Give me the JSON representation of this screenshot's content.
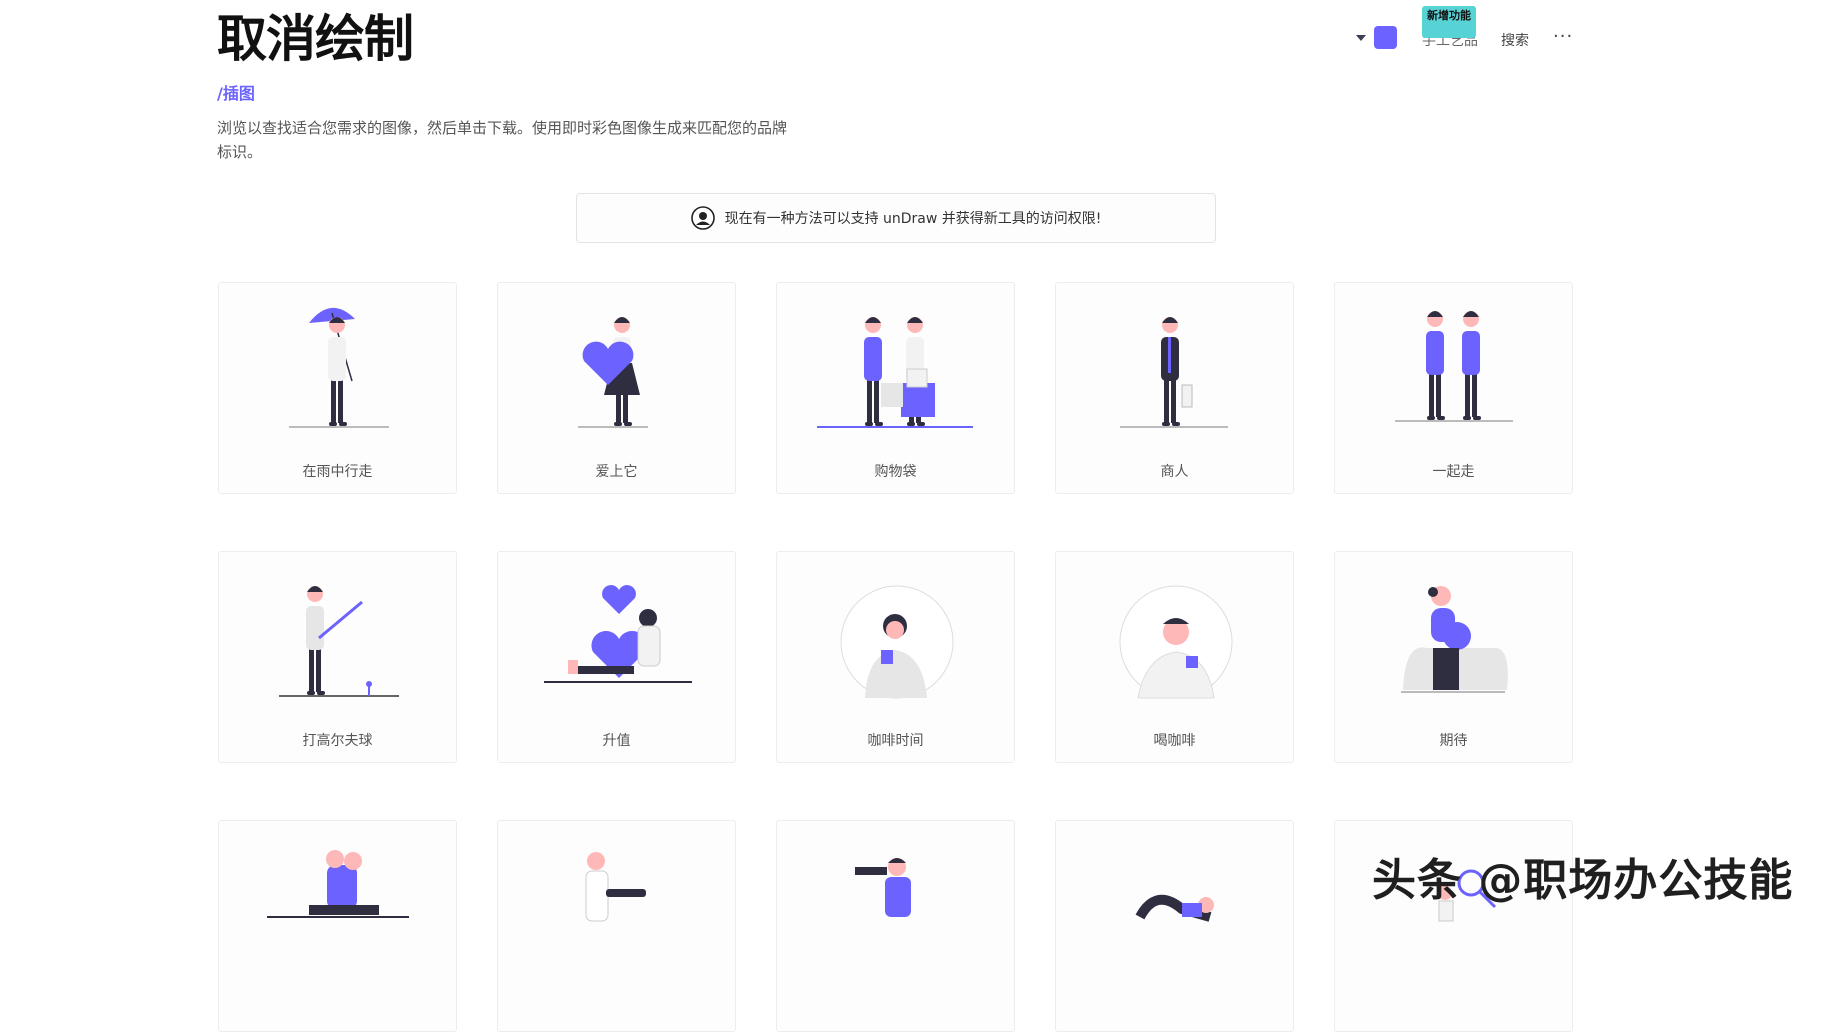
{
  "header": {
    "title": "取消绘制",
    "breadcrumb": "/插图",
    "description": "浏览以查找适合您需求的图像，然后单击下载。使用即时彩色图像生成来匹配您的品牌标识。"
  },
  "nav": {
    "accent_color": "#6c63ff",
    "handmade_label": "手工艺品",
    "new_badge": "新增功能",
    "search_label": "搜索",
    "more_label": "···"
  },
  "banner": {
    "text": "现在有一种方法可以支持 unDraw 并获得新工具的访问权限!",
    "icon": "avatar-icon"
  },
  "illustrations": [
    {
      "label": "在雨中行走",
      "art": "walking-in-rain"
    },
    {
      "label": "爱上它",
      "art": "love-it"
    },
    {
      "label": "购物袋",
      "art": "shopping-bags"
    },
    {
      "label": "商人",
      "art": "businessman"
    },
    {
      "label": "一起走",
      "art": "walking-together"
    },
    {
      "label": "打高尔夫球",
      "art": "golf"
    },
    {
      "label": "升值",
      "art": "appreciation"
    },
    {
      "label": "咖啡时间",
      "art": "coffee-time"
    },
    {
      "label": "喝咖啡",
      "art": "drinking-coffee"
    },
    {
      "label": "期待",
      "art": "expecting"
    },
    {
      "label": "",
      "art": "sitting-back-to-back"
    },
    {
      "label": "",
      "art": "doctor"
    },
    {
      "label": "",
      "art": "photographer"
    },
    {
      "label": "",
      "art": "yoga"
    },
    {
      "label": "",
      "art": "searching"
    }
  ],
  "watermark": "头条 @职场办公技能"
}
